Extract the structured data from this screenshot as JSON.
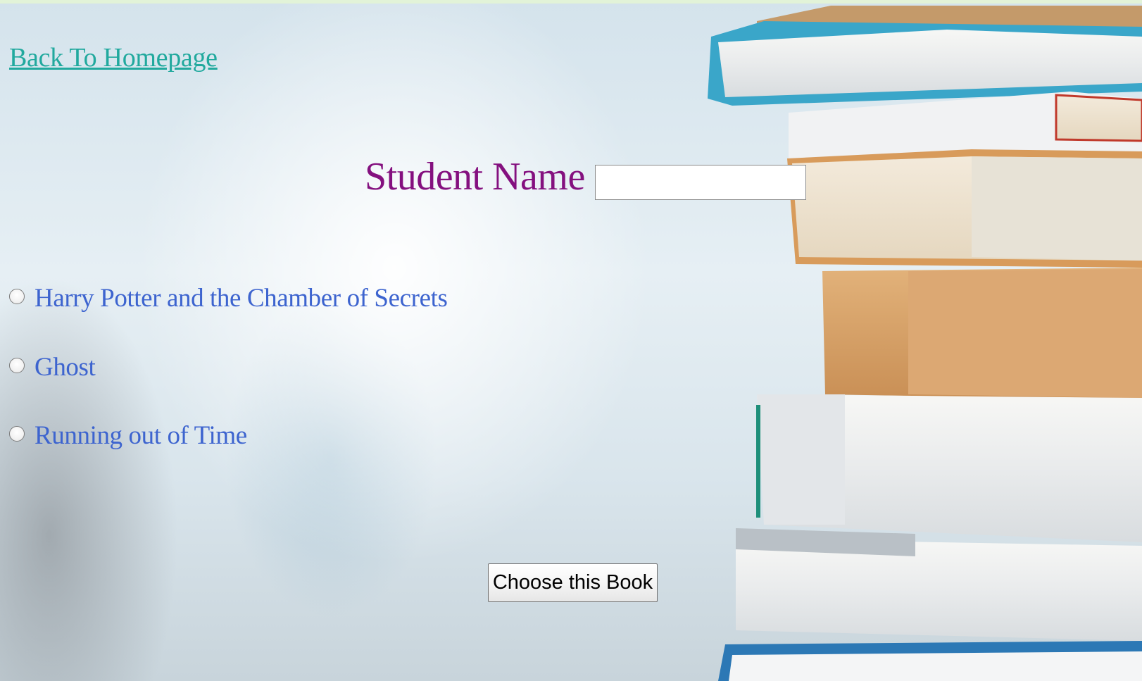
{
  "nav": {
    "back_link": "Back To Homepage"
  },
  "form": {
    "student_name_label": "Student Name",
    "student_name_value": "",
    "books": [
      {
        "label": "Harry Potter and the Chamber of Secrets",
        "selected": false
      },
      {
        "label": "Ghost",
        "selected": false
      },
      {
        "label": "Running out of Time",
        "selected": false
      }
    ],
    "submit_label": "Choose this Book"
  },
  "colors": {
    "link": "#21a99e",
    "label": "#84107f",
    "option_text": "#3d64cf"
  }
}
